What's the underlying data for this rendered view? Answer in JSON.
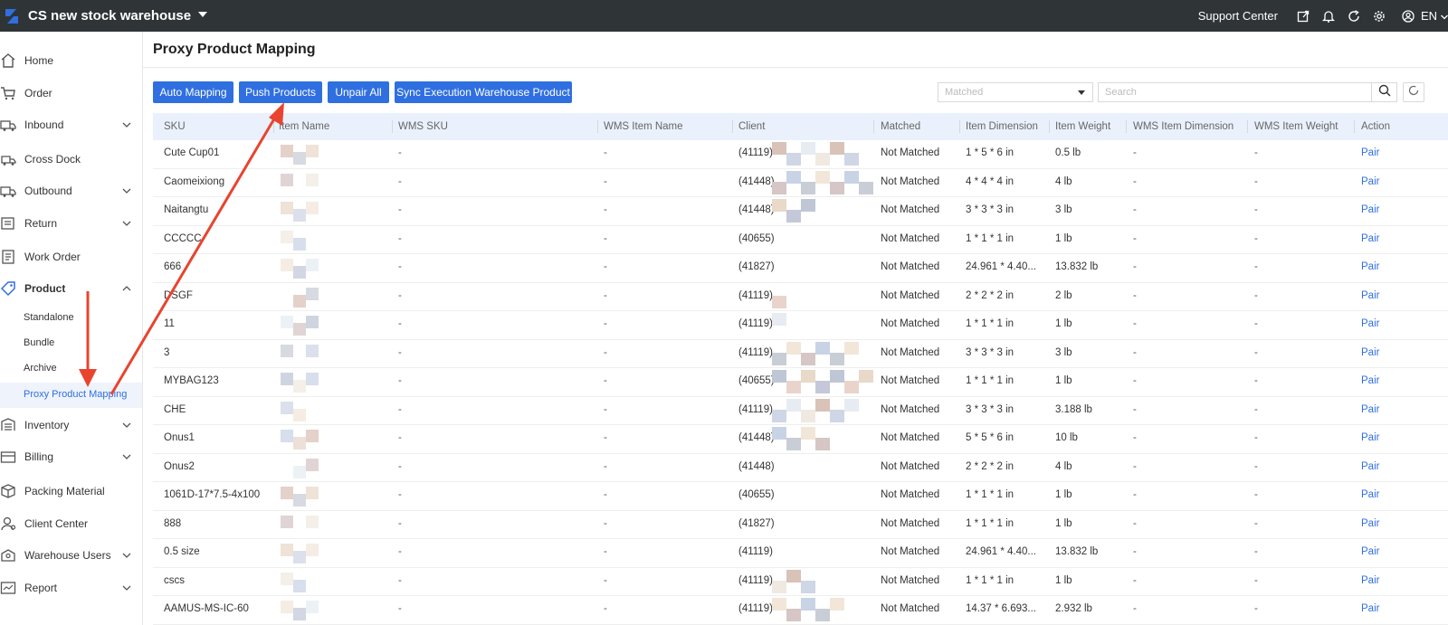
{
  "topbar": {
    "warehouse_name": "CS new stock warehouse",
    "support_label": "Support Center",
    "language": "EN",
    "brand_color": "#2f6fe0",
    "bar_color": "#2f3437"
  },
  "sidebar": {
    "items": [
      {
        "label": "Home",
        "icon": "home-icon"
      },
      {
        "label": "Order",
        "icon": "cart-icon"
      },
      {
        "label": "Inbound",
        "icon": "inbound-truck-icon"
      },
      {
        "label": "Cross Dock",
        "icon": "cross-dock-icon"
      },
      {
        "label": "Outbound",
        "icon": "outbound-truck-icon"
      },
      {
        "label": "Return",
        "icon": "return-icon"
      },
      {
        "label": "Work Order",
        "icon": "work-order-icon"
      },
      {
        "label": "Product",
        "icon": "tag-icon"
      },
      {
        "label": "Inventory",
        "icon": "inventory-icon"
      },
      {
        "label": "Billing",
        "icon": "billing-icon"
      },
      {
        "label": "Packing Material",
        "icon": "box-icon"
      },
      {
        "label": "Client Center",
        "icon": "client-icon"
      },
      {
        "label": "Warehouse Users",
        "icon": "users-icon"
      },
      {
        "label": "Report",
        "icon": "report-icon"
      }
    ],
    "product_sub": [
      "Standalone",
      "Bundle",
      "Archive",
      "Proxy Product Mapping"
    ]
  },
  "page": {
    "title": "Proxy Product Mapping",
    "buttons": [
      "Auto Mapping",
      "Push Products",
      "Unpair All",
      "Sync Execution Warehouse Product"
    ],
    "filter_placeholder": "Matched",
    "search_placeholder": "Search"
  },
  "table": {
    "columns": [
      "SKU",
      "Item Name",
      "WMS SKU",
      "WMS Item Name",
      "Client",
      "Matched",
      "Item Dimension",
      "Item Weight",
      "WMS Item Dimension",
      "WMS Item Weight",
      "Action"
    ],
    "rows": [
      {
        "sku": "Cute Cup01",
        "wms_sku": "-",
        "wms_item_name": "-",
        "client": "(41119)",
        "matched": "Not Matched",
        "dim": "1 * 5 * 6 in",
        "weight": "0.5 lb",
        "wms_dim": "-",
        "wms_weight": "-",
        "action": "Pair"
      },
      {
        "sku": "Caomeixiong",
        "wms_sku": "-",
        "wms_item_name": "-",
        "client": "(41448)",
        "matched": "Not Matched",
        "dim": "4 * 4 * 4 in",
        "weight": "4 lb",
        "wms_dim": "-",
        "wms_weight": "-",
        "action": "Pair"
      },
      {
        "sku": "Naitangtu",
        "wms_sku": "-",
        "wms_item_name": "-",
        "client": "(41448)",
        "matched": "Not Matched",
        "dim": "3 * 3 * 3 in",
        "weight": "3 lb",
        "wms_dim": "-",
        "wms_weight": "-",
        "action": "Pair"
      },
      {
        "sku": "CCCCC",
        "wms_sku": "-",
        "wms_item_name": "-",
        "client": "(40655)",
        "matched": "Not Matched",
        "dim": "1 * 1 * 1 in",
        "weight": "1 lb",
        "wms_dim": "-",
        "wms_weight": "-",
        "action": "Pair"
      },
      {
        "sku": "666",
        "wms_sku": "-",
        "wms_item_name": "-",
        "client": "(41827)",
        "matched": "Not Matched",
        "dim": "24.961 * 4.40...",
        "weight": "13.832 lb",
        "wms_dim": "-",
        "wms_weight": "-",
        "action": "Pair"
      },
      {
        "sku": "DSGF",
        "wms_sku": "-",
        "wms_item_name": "-",
        "client": "(41119)",
        "matched": "Not Matched",
        "dim": "2 * 2 * 2 in",
        "weight": "2 lb",
        "wms_dim": "-",
        "wms_weight": "-",
        "action": "Pair"
      },
      {
        "sku": "11",
        "wms_sku": "-",
        "wms_item_name": "-",
        "client": "(41119)",
        "matched": "Not Matched",
        "dim": "1 * 1 * 1 in",
        "weight": "1 lb",
        "wms_dim": "-",
        "wms_weight": "-",
        "action": "Pair"
      },
      {
        "sku": "3",
        "wms_sku": "-",
        "wms_item_name": "-",
        "client": "(41119)",
        "matched": "Not Matched",
        "dim": "3 * 3 * 3 in",
        "weight": "3 lb",
        "wms_dim": "-",
        "wms_weight": "-",
        "action": "Pair"
      },
      {
        "sku": "MYBAG123",
        "wms_sku": "-",
        "wms_item_name": "-",
        "client": "(40655)",
        "matched": "Not Matched",
        "dim": "1 * 1 * 1 in",
        "weight": "1 lb",
        "wms_dim": "-",
        "wms_weight": "-",
        "action": "Pair"
      },
      {
        "sku": "CHE",
        "wms_sku": "-",
        "wms_item_name": "-",
        "client": "(41119)",
        "matched": "Not Matched",
        "dim": "3 * 3 * 3 in",
        "weight": "3.188 lb",
        "wms_dim": "-",
        "wms_weight": "-",
        "action": "Pair"
      },
      {
        "sku": "Onus1",
        "wms_sku": "-",
        "wms_item_name": "-",
        "client": "(41448)",
        "matched": "Not Matched",
        "dim": "5 * 5 * 6 in",
        "weight": "10 lb",
        "wms_dim": "-",
        "wms_weight": "-",
        "action": "Pair"
      },
      {
        "sku": "Onus2",
        "wms_sku": "-",
        "wms_item_name": "-",
        "client": "(41448)",
        "matched": "Not Matched",
        "dim": "2 * 2 * 2 in",
        "weight": "4 lb",
        "wms_dim": "-",
        "wms_weight": "-",
        "action": "Pair"
      },
      {
        "sku": "1061D-17*7.5-4x100",
        "wms_sku": "-",
        "wms_item_name": "-",
        "client": "(40655)",
        "matched": "Not Matched",
        "dim": "1 * 1 * 1 in",
        "weight": "1 lb",
        "wms_dim": "-",
        "wms_weight": "-",
        "action": "Pair"
      },
      {
        "sku": "888",
        "wms_sku": "-",
        "wms_item_name": "-",
        "client": "(41827)",
        "matched": "Not Matched",
        "dim": "1 * 1 * 1 in",
        "weight": "1 lb",
        "wms_dim": "-",
        "wms_weight": "-",
        "action": "Pair"
      },
      {
        "sku": "0.5 size",
        "wms_sku": "-",
        "wms_item_name": "-",
        "client": "(41119)",
        "matched": "Not Matched",
        "dim": "24.961 * 4.40...",
        "weight": "13.832 lb",
        "wms_dim": "-",
        "wms_weight": "-",
        "action": "Pair"
      },
      {
        "sku": "cscs",
        "wms_sku": "-",
        "wms_item_name": "-",
        "client": "(41119)",
        "matched": "Not Matched",
        "dim": "1 * 1 * 1 in",
        "weight": "1 lb",
        "wms_dim": "-",
        "wms_weight": "-",
        "action": "Pair"
      },
      {
        "sku": "AAMUS-MS-IC-60",
        "wms_sku": "-",
        "wms_item_name": "-",
        "client": "(41119)",
        "matched": "Not Matched",
        "dim": "14.37 * 6.693...",
        "weight": "2.932 lb",
        "wms_dim": "-",
        "wms_weight": "-",
        "action": "Pair"
      }
    ]
  },
  "annotation_color": "#e8442f"
}
